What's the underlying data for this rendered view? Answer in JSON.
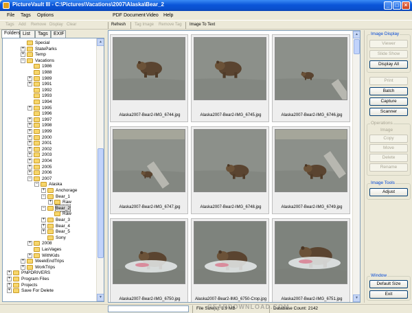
{
  "window": {
    "title": "PictureVault III - C:\\Pictures\\Vacations\\2007\\Alaska\\Bear_2",
    "min": "_",
    "max": "□",
    "close": "×"
  },
  "menu": [
    "File",
    "Tags",
    "Options",
    "PDF Document",
    "Video",
    "Help"
  ],
  "toolbar_left": [
    "Tags",
    "Add",
    "Remove",
    "Display",
    "Clear"
  ],
  "toolbar_right": [
    "Refresh",
    "Tag Image",
    "Remove Tag",
    "Image To Text"
  ],
  "tabs": [
    "Folders",
    "List",
    "Tags",
    "EXIF"
  ],
  "tree": [
    {
      "label": "Special",
      "exp": ""
    },
    {
      "label": "StateParks",
      "exp": "+"
    },
    {
      "label": "Temp",
      "exp": "+"
    },
    {
      "label": "Vacations",
      "exp": "−"
    },
    {
      "label": "1986",
      "exp": ""
    },
    {
      "label": "1988",
      "exp": ""
    },
    {
      "label": "1989",
      "exp": "+"
    },
    {
      "label": "1991",
      "exp": "+"
    },
    {
      "label": "1992",
      "exp": ""
    },
    {
      "label": "1993",
      "exp": ""
    },
    {
      "label": "1994",
      "exp": ""
    },
    {
      "label": "1995",
      "exp": "+"
    },
    {
      "label": "1996",
      "exp": ""
    },
    {
      "label": "1997",
      "exp": "+"
    },
    {
      "label": "1998",
      "exp": "+"
    },
    {
      "label": "1999",
      "exp": "+"
    },
    {
      "label": "2000",
      "exp": "+"
    },
    {
      "label": "2001",
      "exp": "+"
    },
    {
      "label": "2002",
      "exp": "+"
    },
    {
      "label": "2003",
      "exp": "+"
    },
    {
      "label": "2004",
      "exp": "+"
    },
    {
      "label": "2005",
      "exp": "+"
    },
    {
      "label": "2006",
      "exp": "+"
    },
    {
      "label": "2007",
      "exp": "−"
    },
    {
      "label": "Alaska",
      "exp": "−"
    },
    {
      "label": "Anchorage",
      "exp": "+"
    },
    {
      "label": "Bear_1",
      "exp": "−"
    },
    {
      "label": "Raw",
      "exp": "+"
    },
    {
      "label": "Bear_2",
      "exp": "−"
    },
    {
      "label": "Raw",
      "exp": ""
    },
    {
      "label": "Bear_3",
      "exp": "+"
    },
    {
      "label": "Bear_4",
      "exp": "+"
    },
    {
      "label": "Bear_5",
      "exp": "+"
    },
    {
      "label": "Sony",
      "exp": ""
    },
    {
      "label": "2008",
      "exp": "+"
    },
    {
      "label": "LasVages",
      "exp": ""
    },
    {
      "label": "WithKids",
      "exp": "+"
    },
    {
      "label": "WeekEndTrips",
      "exp": "+"
    },
    {
      "label": "WorkTrips",
      "exp": "+"
    },
    {
      "label": "PNPDRIVERS",
      "exp": "+"
    },
    {
      "label": "Program Files",
      "exp": "+"
    },
    {
      "label": "Projects",
      "exp": "+"
    },
    {
      "label": "Save For Delete",
      "exp": "+"
    }
  ],
  "thumbnails": [
    {
      "caption": "Alaska2007-Bear2-IMG_6744.jpg"
    },
    {
      "caption": "Alaska2007-Bear2-IMG_6745.jpg"
    },
    {
      "caption": "Alaska2007-Bear2-IMG_6746.jpg"
    },
    {
      "caption": "Alaska2007-Bear2-IMG_6747.jpg"
    },
    {
      "caption": "Alaska2007-Bear2-IMG_6748.jpg"
    },
    {
      "caption": "Alaska2007-Bear2-IMG_6749.jpg"
    },
    {
      "caption": "Alaska2007-Bear2-IMG_6750.jpg"
    },
    {
      "caption": "Alaska2007-Bear2-IMG_6750-Crop.jpg"
    },
    {
      "caption": "Alaska2007-Bear2-IMG_6751.jpg"
    }
  ],
  "panel": {
    "image_display": {
      "title": "Image Display",
      "viewer": "Viewer",
      "slideshow": "Slide Show",
      "display_all": "Display All"
    },
    "actions": {
      "print": "Print",
      "batch": "Batch",
      "capture": "Capture",
      "scanner": "Scanner"
    },
    "operations": {
      "title": "Operations",
      "sub": "Image",
      "copy": "Copy",
      "move": "Move",
      "delete": "Delete",
      "rename": "Rename"
    },
    "image_tools": {
      "title": "Image Tools",
      "adjust": "Adjust"
    },
    "window": {
      "title": "Window",
      "default_size": "Default Size",
      "exit": "Exit"
    }
  },
  "status": {
    "file_size": "File Size(s): 1.9 MB",
    "db": "Database Count: 2142"
  },
  "watermark": "GEARDOWNLOAD.COM"
}
